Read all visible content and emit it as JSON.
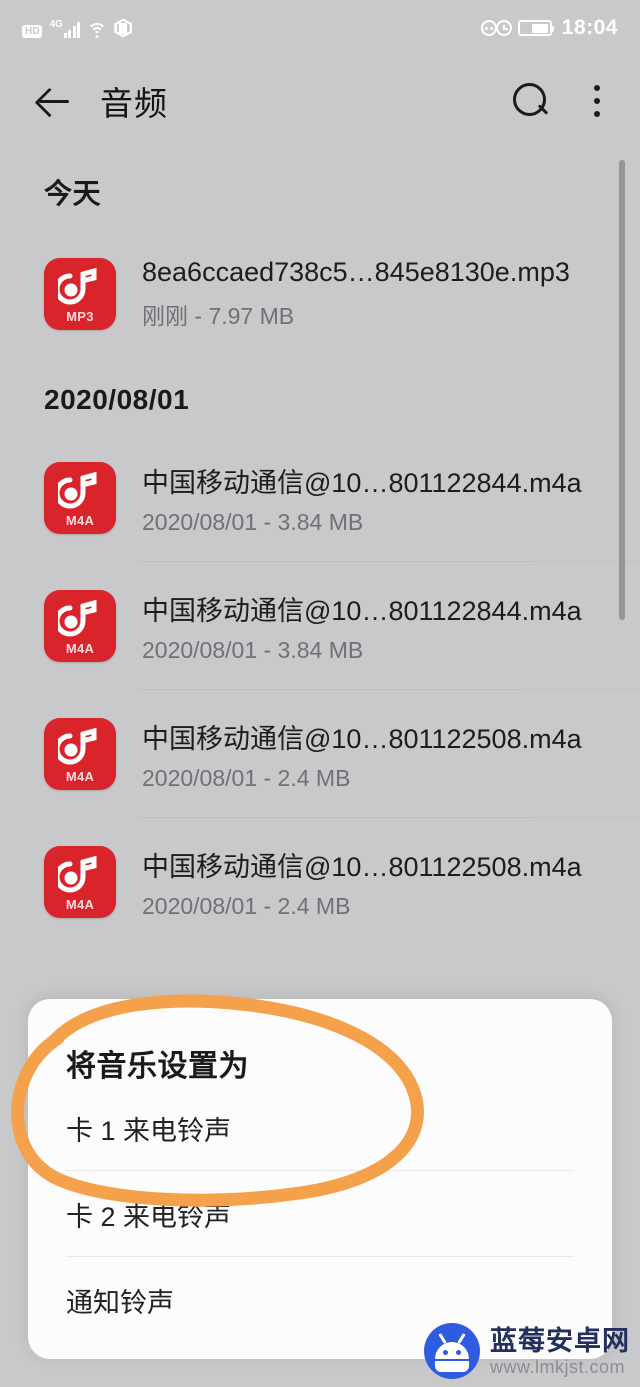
{
  "status_bar": {
    "hd_label": "HD",
    "network_label": "4G",
    "signal_icon": "signal-bars-icon",
    "wifi_icon": "wifi-icon",
    "vpn_icon": "shield-icon",
    "alarm_icon": "alarm-icon",
    "clock_icon": "clock-icon",
    "battery_icon": "battery-icon",
    "time": "18:04"
  },
  "app_bar": {
    "back_icon": "back-arrow-icon",
    "title": "音频",
    "search_icon": "search-icon",
    "more_icon": "more-options-icon"
  },
  "sections": [
    {
      "header": "今天",
      "items": [
        {
          "ext": "MP3",
          "name": "8ea6ccaed738c5…845e8130e.mp3",
          "meta": "刚刚 - 7.97 MB"
        }
      ]
    },
    {
      "header": "2020/08/01",
      "items": [
        {
          "ext": "M4A",
          "name": "中国移动通信@10…801122844.m4a",
          "meta": "2020/08/01 - 3.84 MB"
        },
        {
          "ext": "M4A",
          "name": "中国移动通信@10…801122844.m4a",
          "meta": "2020/08/01 - 3.84 MB"
        },
        {
          "ext": "M4A",
          "name": "中国移动通信@10…801122508.m4a",
          "meta": "2020/08/01 - 2.4 MB"
        },
        {
          "ext": "M4A",
          "name": "中国移动通信@10…801122508.m4a",
          "meta": "2020/08/01 - 2.4 MB"
        }
      ]
    }
  ],
  "bottom_sheet": {
    "title": "将音乐设置为",
    "options": [
      {
        "label": "卡 1 来电铃声"
      },
      {
        "label": "卡 2 来电铃声"
      },
      {
        "label": "通知铃声"
      }
    ]
  },
  "annotation": {
    "shape": "hand-drawn-ellipse",
    "color": "#f5a04a",
    "targets": "将音乐设置为 / 卡 1 来电铃声"
  },
  "watermark": {
    "logo_icon": "android-robot-icon",
    "site_name": "蓝莓安卓网",
    "url": "www.lmkjst.com"
  },
  "colors": {
    "background": "#c9c9cb",
    "sheet": "#fcfcfc",
    "file_icon": "#d9242b",
    "accent_orange": "#f5a04a",
    "watermark_blue": "#2f5be0"
  }
}
